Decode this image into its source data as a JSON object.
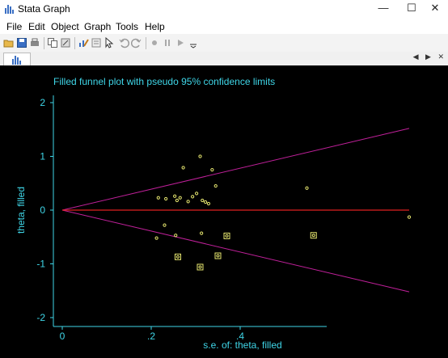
{
  "window": {
    "title": "Stata Graph",
    "minimize": "—",
    "maximize": "☐",
    "close": "✕"
  },
  "menu": [
    "File",
    "Edit",
    "Object",
    "Graph",
    "Tools",
    "Help"
  ],
  "toolbar": [
    "open-icon",
    "save-icon",
    "print-icon",
    "copy-icon",
    "rename-icon",
    "graph-editor-icon",
    "properties-icon",
    "pointer-icon",
    "undo-icon",
    "redo-icon",
    "record-icon",
    "pause-icon",
    "play-icon",
    "dropdown-icon"
  ],
  "tab_strip": {
    "nav": "◀ ▶ ✕"
  },
  "colors": {
    "background": "#000000",
    "axis": "#3fd6e8",
    "pseudo_ci": "#c0209a",
    "reference": "#e02020",
    "observed": "#e8e870",
    "filled": "#e8e870"
  },
  "chart_data": {
    "type": "scatter",
    "title": "Filled funnel plot with pseudo 95% confidence limits",
    "xlabel": "s.e. of: theta, filled",
    "ylabel": "theta, filled",
    "xlim": [
      0,
      0.59
    ],
    "ylim": [
      -2,
      2
    ],
    "xticks": [
      "0",
      ".2",
      ".4"
    ],
    "yticks": [
      "2",
      "1",
      "0",
      "-1",
      "-2"
    ],
    "grid": false,
    "reference_line": 0,
    "pseudo_ci_upper": [
      [
        0,
        0
      ],
      [
        0.78,
        1.52
      ]
    ],
    "pseudo_ci_lower": [
      [
        0,
        0
      ],
      [
        0.78,
        -1.52
      ]
    ],
    "series": [
      {
        "points": [
          [
            0.216,
            0.23
          ],
          [
            0.233,
            0.21
          ],
          [
            0.253,
            0.26
          ],
          [
            0.258,
            0.18
          ],
          [
            0.265,
            0.23
          ],
          [
            0.272,
            0.79
          ],
          [
            0.283,
            0.16
          ],
          [
            0.293,
            0.25
          ],
          [
            0.302,
            0.31
          ],
          [
            0.31,
            1.0
          ],
          [
            0.315,
            0.18
          ],
          [
            0.322,
            0.15
          ],
          [
            0.329,
            0.12
          ],
          [
            0.337,
            0.75
          ],
          [
            0.345,
            0.45
          ],
          [
            0.55,
            0.41
          ],
          [
            0.78,
            -0.13
          ],
          [
            0.212,
            -0.52
          ],
          [
            0.255,
            -0.47
          ],
          [
            0.23,
            -0.28
          ],
          [
            0.313,
            -0.43
          ]
        ]
      },
      {
        "points": [
          [
            0.37,
            -0.48
          ],
          [
            0.26,
            -0.87
          ],
          [
            0.31,
            -1.06
          ],
          [
            0.35,
            -0.85
          ],
          [
            0.565,
            -0.47
          ]
        ]
      }
    ]
  }
}
